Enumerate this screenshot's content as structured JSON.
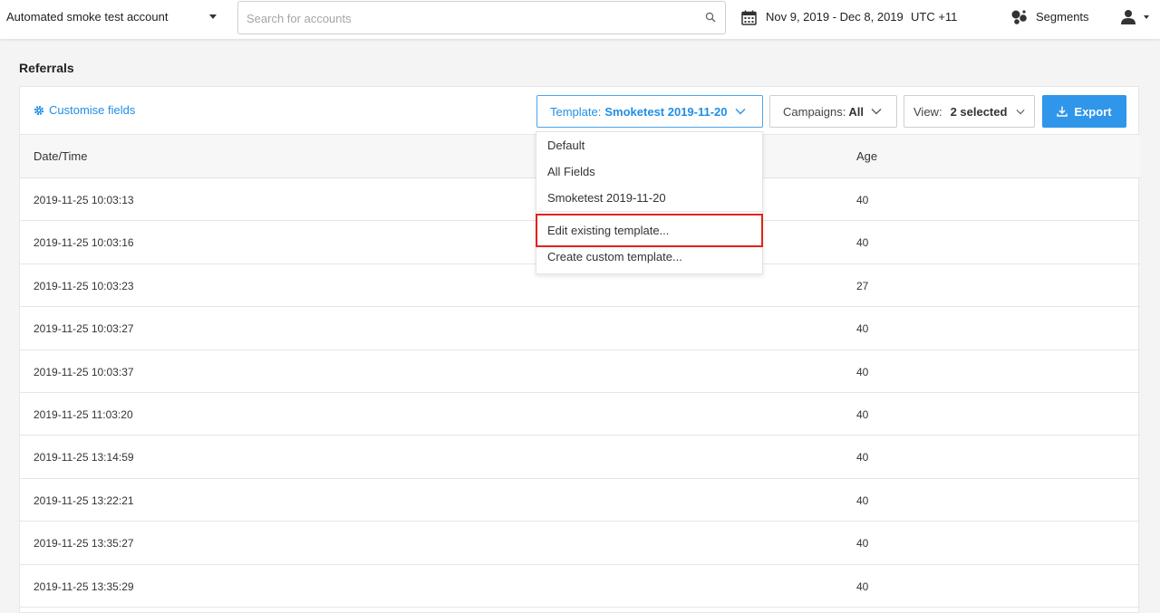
{
  "topbar": {
    "account": "Automated smoke test account",
    "search_placeholder": "Search for accounts",
    "date_range": "Nov 9, 2019 - Dec 8, 2019",
    "timezone": "UTC +11",
    "segments": "Segments"
  },
  "page": {
    "title": "Referrals"
  },
  "toolbar": {
    "customise": "Customise fields",
    "template_label": "Template:",
    "template_value": "Smoketest 2019-11-20",
    "campaigns_label": "Campaigns:",
    "campaigns_value": "All",
    "view_label": "View:",
    "view_value": "2 selected",
    "export": "Export"
  },
  "table": {
    "headers": {
      "date": "Date/Time",
      "age": "Age"
    },
    "rows": [
      {
        "date": "2019-11-25 10:03:13",
        "age": "40"
      },
      {
        "date": "2019-11-25 10:03:16",
        "age": "40"
      },
      {
        "date": "2019-11-25 10:03:23",
        "age": "27"
      },
      {
        "date": "2019-11-25 10:03:27",
        "age": "40"
      },
      {
        "date": "2019-11-25 10:03:37",
        "age": "40"
      },
      {
        "date": "2019-11-25 11:03:20",
        "age": "40"
      },
      {
        "date": "2019-11-25 13:14:59",
        "age": "40"
      },
      {
        "date": "2019-11-25 13:22:21",
        "age": "40"
      },
      {
        "date": "2019-11-25 13:35:27",
        "age": "40"
      },
      {
        "date": "2019-11-25 13:35:29",
        "age": "40"
      }
    ]
  },
  "dropdown": {
    "items": [
      "Default",
      "All Fields",
      "Smoketest 2019-11-20",
      "Edit existing template...",
      "Create custom template..."
    ]
  },
  "colors": {
    "accent": "#1f8ee6",
    "export_bg": "#2f96ea",
    "highlight": "#e2231a"
  },
  "icons": [
    "calendar-icon",
    "search-icon",
    "segments-icon",
    "user-icon",
    "gear-icon",
    "download-icon",
    "chevron-down-icon"
  ]
}
